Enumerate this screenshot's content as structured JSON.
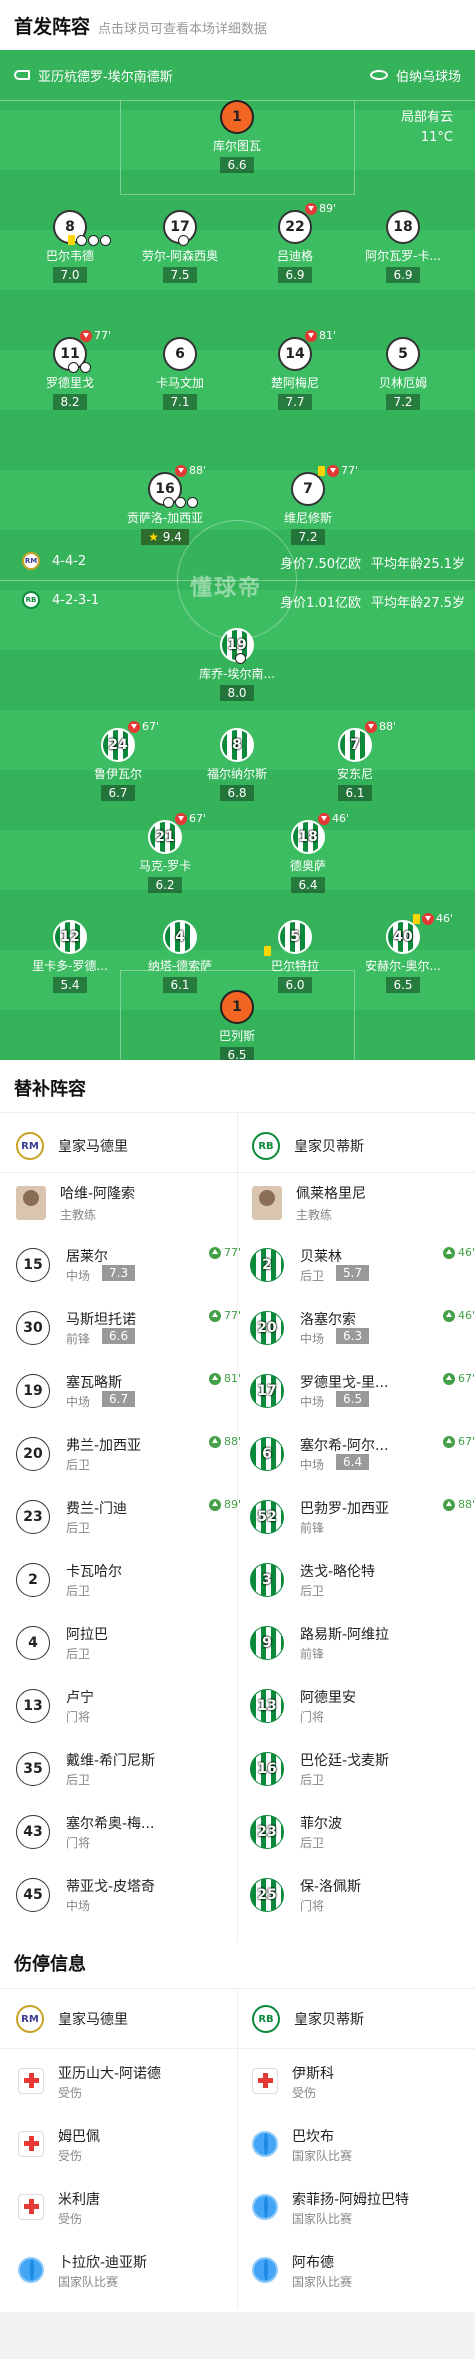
{
  "header": {
    "title": "首发阵容",
    "subtitle": "点击球员可查看本场详细数据"
  },
  "venue": {
    "referee": "亚历杭德罗-埃尔南德斯",
    "stadium": "伯纳乌球场"
  },
  "weather": {
    "desc": "局部有云",
    "temp": "11°C"
  },
  "watermark": "懂球帝",
  "home": {
    "formation": "4-4-2",
    "value": "身价7.50亿欧",
    "age": "平均年龄25.1岁",
    "players": [
      {
        "num": "1",
        "name": "库尔图瓦",
        "rating": "6.6"
      },
      {
        "num": "8",
        "name": "巴尔韦德",
        "rating": "7.0"
      },
      {
        "num": "17",
        "name": "劳尔-阿森西奥",
        "rating": "7.5"
      },
      {
        "num": "22",
        "name": "吕迪格",
        "rating": "6.9",
        "sub": "89'"
      },
      {
        "num": "18",
        "name": "阿尔瓦罗-卡...",
        "rating": "6.9"
      },
      {
        "num": "11",
        "name": "罗德里戈",
        "rating": "8.2",
        "sub": "77'"
      },
      {
        "num": "6",
        "name": "卡马文加",
        "rating": "7.1"
      },
      {
        "num": "14",
        "name": "楚阿梅尼",
        "rating": "7.7",
        "sub": "81'"
      },
      {
        "num": "5",
        "name": "贝林厄姆",
        "rating": "7.2"
      },
      {
        "num": "16",
        "name": "贡萨洛-加西亚",
        "rating": "9.4",
        "sub": "88'"
      },
      {
        "num": "7",
        "name": "维尼修斯",
        "rating": "7.2",
        "sub": "77'"
      }
    ]
  },
  "away": {
    "formation": "4-2-3-1",
    "value": "身价1.01亿欧",
    "age": "平均年龄27.5岁",
    "players": [
      {
        "num": "19",
        "name": "库乔-埃尔南...",
        "rating": "8.0"
      },
      {
        "num": "24",
        "name": "鲁伊瓦尔",
        "rating": "6.7",
        "sub": "67'"
      },
      {
        "num": "8",
        "name": "福尔纳尔斯",
        "rating": "6.8"
      },
      {
        "num": "7",
        "name": "安东尼",
        "rating": "6.1",
        "sub": "88'"
      },
      {
        "num": "21",
        "name": "马克-罗卡",
        "rating": "6.2",
        "sub": "67'"
      },
      {
        "num": "18",
        "name": "德奥萨",
        "rating": "6.4",
        "sub": "46'"
      },
      {
        "num": "12",
        "name": "里卡多-罗德...",
        "rating": "5.4"
      },
      {
        "num": "4",
        "name": "纳塔-德索萨",
        "rating": "6.1"
      },
      {
        "num": "5",
        "name": "巴尔特拉",
        "rating": "6.0"
      },
      {
        "num": "40",
        "name": "安赫尔-奥尔...",
        "rating": "6.5",
        "sub": "46'"
      },
      {
        "num": "1",
        "name": "巴列斯",
        "rating": "6.5"
      }
    ]
  },
  "subs": {
    "title": "替补阵容",
    "home_team": "皇家马德里",
    "away_team": "皇家贝蒂斯",
    "home_coach": {
      "name": "哈维-阿隆索",
      "role": "主教练"
    },
    "away_coach": {
      "name": "佩莱格里尼",
      "role": "主教练"
    },
    "home": [
      {
        "num": "15",
        "name": "居莱尔",
        "pos": "中场",
        "rating": "7.3",
        "sub": "77'"
      },
      {
        "num": "30",
        "name": "马斯坦托诺",
        "pos": "前锋",
        "rating": "6.6",
        "sub": "77'"
      },
      {
        "num": "19",
        "name": "塞瓦略斯",
        "pos": "中场",
        "rating": "6.7",
        "sub": "81'"
      },
      {
        "num": "20",
        "name": "弗兰-加西亚",
        "pos": "后卫",
        "sub": "88'"
      },
      {
        "num": "23",
        "name": "费兰-门迪",
        "pos": "后卫",
        "sub": "89'"
      },
      {
        "num": "2",
        "name": "卡瓦哈尔",
        "pos": "后卫"
      },
      {
        "num": "4",
        "name": "阿拉巴",
        "pos": "后卫"
      },
      {
        "num": "13",
        "name": "卢宁",
        "pos": "门将"
      },
      {
        "num": "35",
        "name": "戴维-希门尼斯",
        "pos": "后卫"
      },
      {
        "num": "43",
        "name": "塞尔希奥-梅...",
        "pos": "门将"
      },
      {
        "num": "45",
        "name": "蒂亚戈-皮塔奇",
        "pos": "中场"
      }
    ],
    "away": [
      {
        "num": "2",
        "name": "贝莱林",
        "pos": "后卫",
        "rating": "5.7",
        "sub": "46'"
      },
      {
        "num": "20",
        "name": "洛塞尔索",
        "pos": "中场",
        "rating": "6.3",
        "sub": "46'"
      },
      {
        "num": "17",
        "name": "罗德里戈-里...",
        "pos": "中场",
        "rating": "6.5",
        "sub": "67'"
      },
      {
        "num": "6",
        "name": "塞尔希-阿尔...",
        "pos": "中场",
        "rating": "6.4",
        "sub": "67'"
      },
      {
        "num": "52",
        "name": "巴勃罗-加西亚",
        "pos": "前锋",
        "sub": "88'"
      },
      {
        "num": "3",
        "name": "迭戈-略伦特",
        "pos": "后卫"
      },
      {
        "num": "9",
        "name": "路易斯-阿维拉",
        "pos": "前锋"
      },
      {
        "num": "13",
        "name": "阿德里安",
        "pos": "门将"
      },
      {
        "num": "16",
        "name": "巴伦廷-戈麦斯",
        "pos": "后卫"
      },
      {
        "num": "23",
        "name": "菲尔波",
        "pos": "后卫"
      },
      {
        "num": "25",
        "name": "保-洛佩斯",
        "pos": "门将"
      }
    ]
  },
  "injuries": {
    "title": "伤停信息",
    "home_team": "皇家马德里",
    "away_team": "皇家贝蒂斯",
    "home": [
      {
        "name": "亚历山大-阿诺德",
        "reason": "受伤",
        "icon": "medical-cross-icon"
      },
      {
        "name": "姆巴佩",
        "reason": "受伤",
        "icon": "medical-cross-icon"
      },
      {
        "name": "米利唐",
        "reason": "受伤",
        "icon": "medical-cross-icon"
      },
      {
        "name": "卜拉欣-迪亚斯",
        "reason": "国家队比赛",
        "icon": "globe-icon"
      }
    ],
    "away": [
      {
        "name": "伊斯科",
        "reason": "受伤",
        "icon": "medical-cross-icon"
      },
      {
        "name": "巴坎布",
        "reason": "国家队比赛",
        "icon": "globe-icon"
      },
      {
        "name": "索菲扬-阿姆拉巴特",
        "reason": "国家队比赛",
        "icon": "globe-icon"
      },
      {
        "name": "阿布德",
        "reason": "国家队比赛",
        "icon": "globe-icon"
      }
    ]
  },
  "colors": {
    "pitch": "#35b35a",
    "home_kit": "#ffffff",
    "away_kit": "#0a8a3a",
    "gk": "#f26522",
    "sub_on": "#43a047",
    "sub_off": "#e53935"
  }
}
